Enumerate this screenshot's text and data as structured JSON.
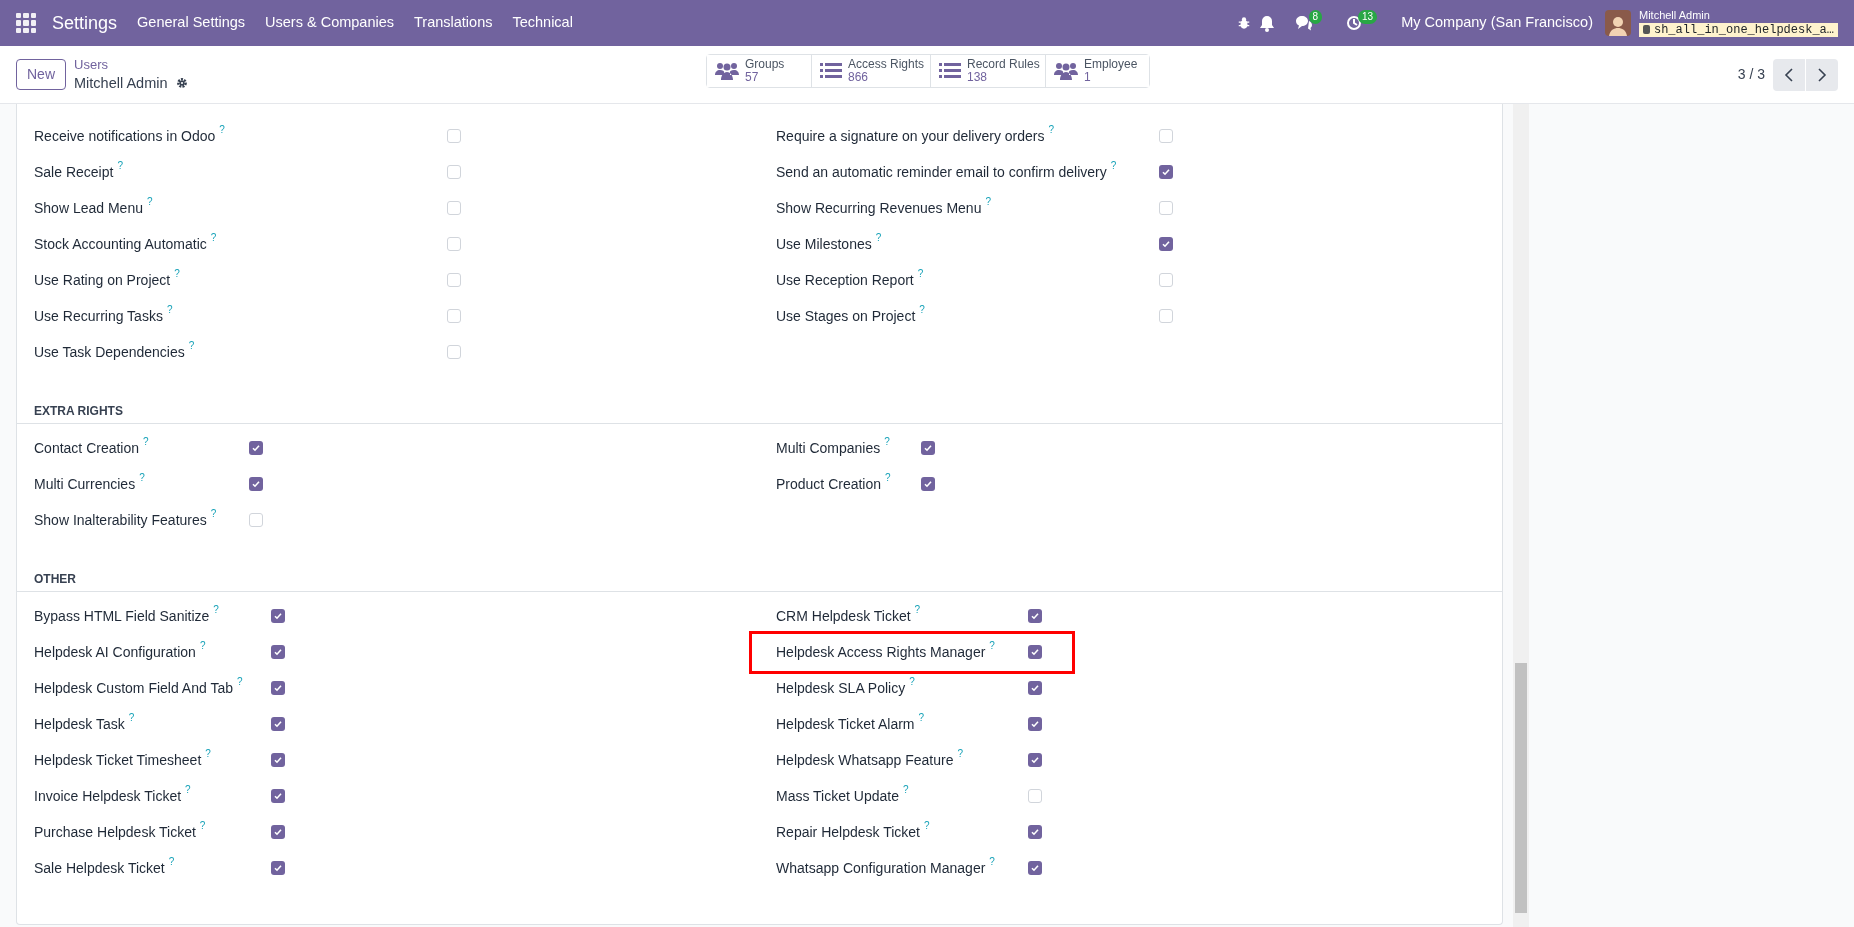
{
  "navbar": {
    "app_title": "Settings",
    "menu": [
      "General Settings",
      "Users & Companies",
      "Translations",
      "Technical"
    ],
    "messages_count": "8",
    "activities_count": "13",
    "company": "My Company (San Francisco)",
    "user_name": "Mitchell Admin",
    "database": "sh_all_in_one_helpdesk_a…"
  },
  "control_panel": {
    "new_button": "New",
    "breadcrumb": "Users",
    "record": "Mitchell Admin",
    "pager": "3 / 3",
    "smart_buttons": [
      {
        "kind": "people",
        "label": "Groups",
        "value": "57"
      },
      {
        "kind": "list",
        "label": "Access Rights",
        "value": "866"
      },
      {
        "kind": "list",
        "label": "Record Rules",
        "value": "138"
      },
      {
        "kind": "people",
        "label": "Employee",
        "value": "1"
      }
    ]
  },
  "sections": [
    {
      "kind": "wide",
      "left": [
        {
          "label": "Receive notifications in Odoo",
          "help": "?",
          "checked": false,
          "highlighted": false
        },
        {
          "label": "Sale Receipt",
          "help": "?",
          "checked": false,
          "highlighted": false
        },
        {
          "label": "Show Lead Menu",
          "help": "?",
          "checked": false,
          "highlighted": false
        },
        {
          "label": "Stock Accounting Automatic",
          "help": "?",
          "checked": false,
          "highlighted": false
        },
        {
          "label": "Use Rating on Project",
          "help": "?",
          "checked": false,
          "highlighted": false
        },
        {
          "label": "Use Recurring Tasks",
          "help": "?",
          "checked": false,
          "highlighted": false
        },
        {
          "label": "Use Task Dependencies",
          "help": "?",
          "checked": false,
          "highlighted": false
        }
      ],
      "right": [
        {
          "label": "Require a signature on your delivery orders",
          "help": "?",
          "checked": false,
          "highlighted": false
        },
        {
          "label": "Send an automatic reminder email to confirm delivery",
          "help": "?",
          "checked": true,
          "highlighted": false
        },
        {
          "label": "Show Recurring Revenues Menu",
          "help": "?",
          "checked": false,
          "highlighted": false
        },
        {
          "label": "Use Milestones",
          "help": "?",
          "checked": true,
          "highlighted": false
        },
        {
          "label": "Use Reception Report",
          "help": "?",
          "checked": false,
          "highlighted": false
        },
        {
          "label": "Use Stages on Project",
          "help": "?",
          "checked": false,
          "highlighted": false
        }
      ]
    },
    {
      "kind": "narrow",
      "title": "EXTRA RIGHTS",
      "left": [
        {
          "label": "Contact Creation",
          "help": "?",
          "checked": true,
          "highlighted": false
        },
        {
          "label": "Multi Currencies",
          "help": "?",
          "checked": true,
          "highlighted": false
        },
        {
          "label": "Show Inalterability Features",
          "help": "?",
          "checked": false,
          "highlighted": false
        }
      ],
      "right": [
        {
          "label": "Multi Companies",
          "help": "?",
          "checked": true,
          "highlighted": false
        },
        {
          "label": "Product Creation",
          "help": "?",
          "checked": true,
          "highlighted": false
        }
      ]
    },
    {
      "kind": "medium",
      "title": "OTHER",
      "left": [
        {
          "label": "Bypass HTML Field Sanitize",
          "help": "?",
          "checked": true,
          "highlighted": false
        },
        {
          "label": "Helpdesk AI Configuration",
          "help": "?",
          "checked": true,
          "highlighted": false
        },
        {
          "label": "Helpdesk Custom Field And Tab",
          "help": "?",
          "checked": true,
          "highlighted": false
        },
        {
          "label": "Helpdesk Task",
          "help": "?",
          "checked": true,
          "highlighted": false
        },
        {
          "label": "Helpdesk Ticket Timesheet",
          "help": "?",
          "checked": true,
          "highlighted": false
        },
        {
          "label": "Invoice Helpdesk Ticket",
          "help": "?",
          "checked": true,
          "highlighted": false
        },
        {
          "label": "Purchase Helpdesk Ticket",
          "help": "?",
          "checked": true,
          "highlighted": false
        },
        {
          "label": "Sale Helpdesk Ticket",
          "help": "?",
          "checked": true,
          "highlighted": false
        }
      ],
      "right": [
        {
          "label": "CRM Helpdesk Ticket",
          "help": "?",
          "checked": true,
          "highlighted": false
        },
        {
          "label": "Helpdesk Access Rights Manager",
          "help": "?",
          "checked": true,
          "highlighted": true
        },
        {
          "label": "Helpdesk SLA Policy",
          "help": "?",
          "checked": true,
          "highlighted": false
        },
        {
          "label": "Helpdesk Ticket Alarm",
          "help": "?",
          "checked": true,
          "highlighted": false
        },
        {
          "label": "Helpdesk Whatsapp Feature",
          "help": "?",
          "checked": true,
          "highlighted": false
        },
        {
          "label": "Mass Ticket Update",
          "help": "?",
          "checked": false,
          "highlighted": false
        },
        {
          "label": "Repair Helpdesk Ticket",
          "help": "?",
          "checked": true,
          "highlighted": false
        },
        {
          "label": "Whatsapp Configuration Manager",
          "help": "?",
          "checked": true,
          "highlighted": false
        }
      ]
    }
  ]
}
